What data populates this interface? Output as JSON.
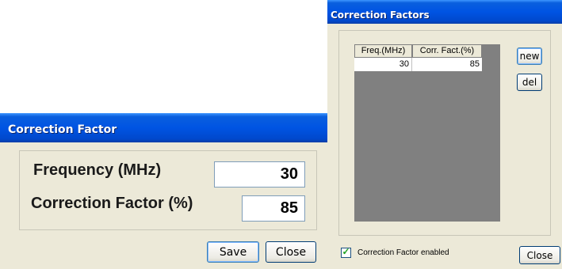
{
  "factors_window": {
    "title": "Correction Factors",
    "table": {
      "columns": [
        "Freq.(MHz)",
        "Corr. Fact.(%)"
      ],
      "rows": [
        [
          "30",
          "85"
        ]
      ]
    },
    "new_label": "new",
    "del_label": "del",
    "enabled_label": "Correction Factor enabled",
    "enabled_checked": true,
    "close_label": "Close"
  },
  "factor_dialog": {
    "title": "Correction Factor",
    "frequency_label": "Frequency (MHz)",
    "frequency_value": "30",
    "factor_label": "Correction Factor (%)",
    "factor_value": "85",
    "save_label": "Save",
    "close_label": "Close"
  }
}
